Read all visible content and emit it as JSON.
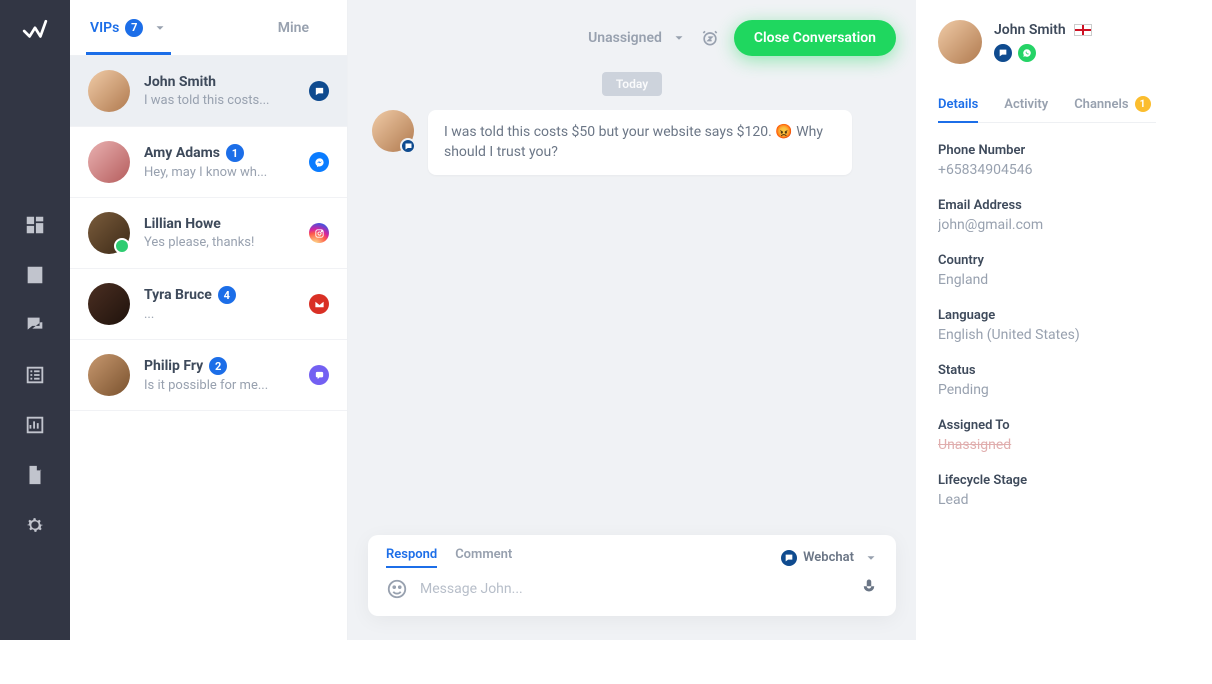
{
  "tabs": {
    "vips_label": "VIPs",
    "vips_count": "7",
    "mine_label": "Mine"
  },
  "conversations": [
    {
      "name": "John Smith",
      "preview": "I was told this costs...",
      "badge": "",
      "source": "webchat"
    },
    {
      "name": "Amy Adams",
      "preview": "Hey, may I know wh...",
      "badge": "1",
      "source": "messenger"
    },
    {
      "name": "Lillian Howe",
      "preview": "Yes please, thanks!",
      "badge": "",
      "source": "instagram"
    },
    {
      "name": "Tyra Bruce",
      "preview": "...",
      "badge": "4",
      "source": "gmail"
    },
    {
      "name": "Philip Fry",
      "preview": "Is it possible for me...",
      "badge": "2",
      "source": "viber"
    }
  ],
  "thread": {
    "assignee_label": "Unassigned",
    "close_label": "Close Conversation",
    "day_marker": "Today",
    "message": "I was told this costs $50 but your website says $120. 😡 Why should I trust you?"
  },
  "composer": {
    "respond_label": "Respond",
    "comment_label": "Comment",
    "channel_label": "Webchat",
    "placeholder": "Message John..."
  },
  "contact": {
    "name": "John Smith",
    "tabs": {
      "details": "Details",
      "activity": "Activity",
      "channels": "Channels",
      "channels_count": "1"
    },
    "fields": {
      "phone_label": "Phone Number",
      "phone_value": "+65834904546",
      "email_label": "Email Address",
      "email_value": "john@gmail.com",
      "country_label": "Country",
      "country_value": "England",
      "language_label": "Language",
      "language_value": "English (United States)",
      "status_label": "Status",
      "status_value": "Pending",
      "assigned_label": "Assigned To",
      "assigned_value": "Unassigned",
      "lifecycle_label": "Lifecycle Stage",
      "lifecycle_value": "Lead"
    }
  }
}
